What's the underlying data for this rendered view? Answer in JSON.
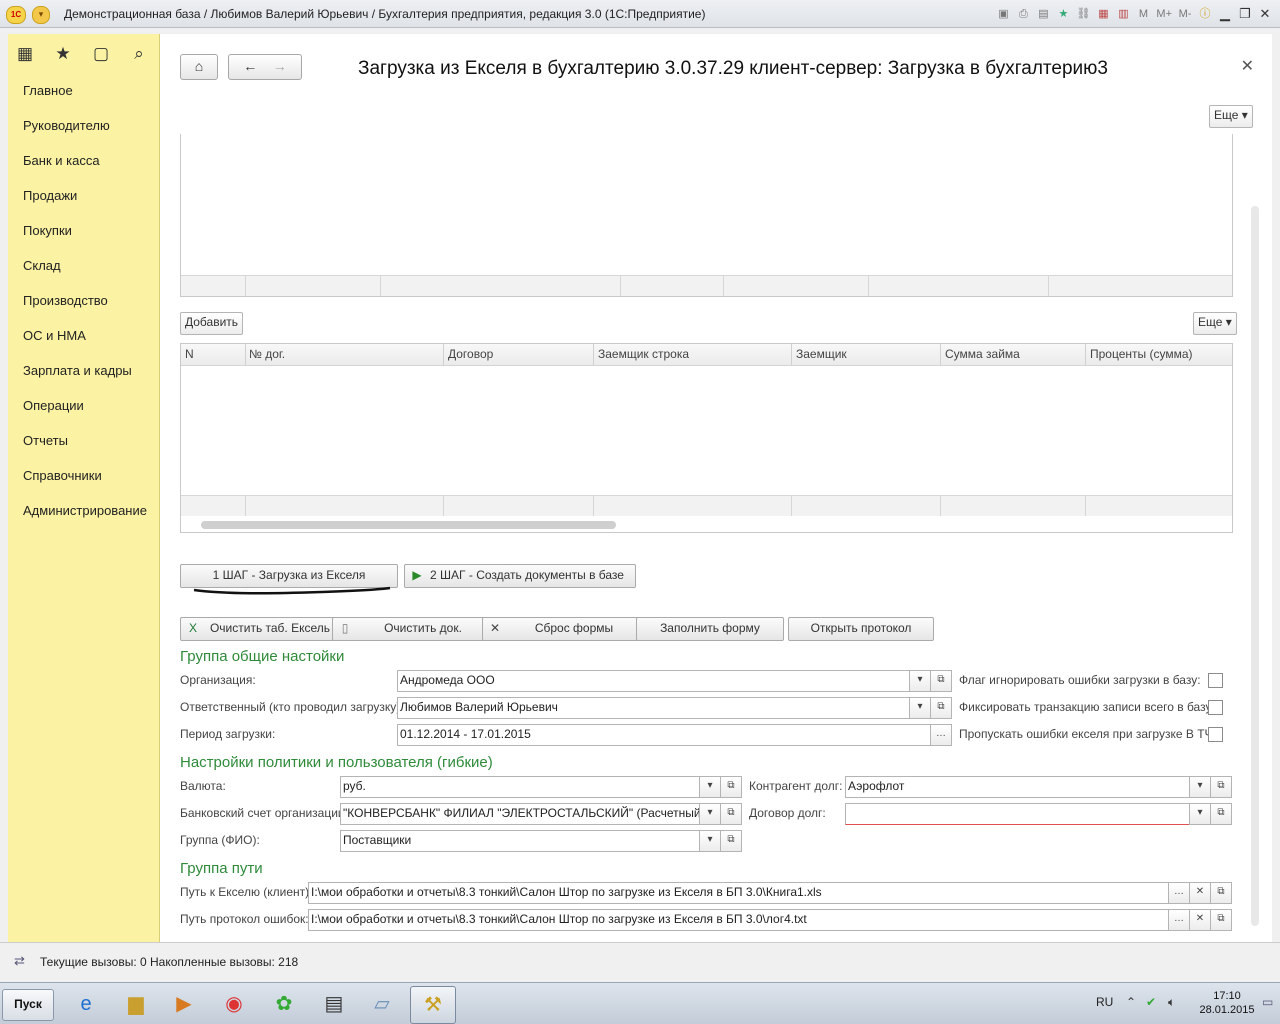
{
  "window": {
    "title": "Демонстрационная база / Любимов Валерий Юрьевич / Бухгалтерия предприятия, редакция 3.0  (1С:Предприятие)",
    "controls": [
      "M",
      "M+",
      "M-"
    ]
  },
  "sidebar": {
    "items": [
      {
        "label": "Главное"
      },
      {
        "label": "Руководителю"
      },
      {
        "label": "Банк и касса"
      },
      {
        "label": "Продажи"
      },
      {
        "label": "Покупки"
      },
      {
        "label": "Склад"
      },
      {
        "label": "Производство"
      },
      {
        "label": "ОС и НМА"
      },
      {
        "label": "Зарплата и кадры"
      },
      {
        "label": "Операции"
      },
      {
        "label": "Отчеты"
      },
      {
        "label": "Справочники"
      },
      {
        "label": "Администрирование"
      }
    ]
  },
  "form": {
    "title": "Загрузка из Екселя в бухгалтерию 3.0.37.29 клиент-сервер: Загрузка в бухгалтерию3",
    "more_label": "Еще ▾",
    "add_label": "Добавить"
  },
  "table": {
    "columns": [
      "N",
      "№ дог.",
      "Договор",
      "Заемщик строка",
      "Заемщик",
      "Сумма займа",
      "Проценты (сумма)"
    ]
  },
  "steps": {
    "step1": "1 ШАГ - Загрузка из Екселя",
    "step2": "2 ШАГ - Создать документы в базе"
  },
  "actions": {
    "clear_excel": "Очистить таб. Ексель",
    "clear_docs": "Очистить док.",
    "reset_form": "Сброс формы",
    "fill_form": "Заполнить форму",
    "open_log": "Открыть протокол"
  },
  "group_general": {
    "title": "Группа общие настойки",
    "org_label": "Организация:",
    "org_value": "Андромеда ООО",
    "resp_label": "Ответственный (кто проводил загрузку):",
    "resp_value": "Любимов Валерий Юрьевич",
    "period_label": "Период загрузки:",
    "period_value": "01.12.2014 - 17.01.2015",
    "flag1": "Флаг игнорировать ошибки загрузки в базу:",
    "flag2": "Фиксировать транзакцию записи всего в базу:",
    "flag3": "Пропускать ошибки екселя при загрузке В ТЧ:"
  },
  "group_policy": {
    "title": "Настройки политики и пользователя (гибкие)",
    "currency_label": "Валюта:",
    "currency_value": "руб.",
    "bank_label": "Банковский счет организации:",
    "bank_value": "\"КОНВЕРСБАНК\" ФИЛИАЛ \"ЭЛЕКТРОСТАЛЬСКИЙ\" (Расчетный)",
    "group_label": "Группа (ФИО):",
    "group_value": "Поставщики",
    "contractor_label": "Контрагент долг:",
    "contractor_value": "Аэрофлот",
    "contract_label": "Договор долг:",
    "contract_value": ""
  },
  "group_paths": {
    "title": "Группа пути",
    "excel_label": "Путь к Екселю (клиент):",
    "excel_value": "I:\\мои обработки и отчеты\\8.3 тонкий\\Салон Штор по загрузке из Екселя в БП 3.0\\Книга1.xls",
    "log_label": "Путь протокол ошибок:",
    "log_value": "I:\\мои обработки и отчеты\\8.3 тонкий\\Салон Штор по загрузке из Екселя в БП 3.0\\лог4.txt"
  },
  "status": {
    "text": "Текущие вызовы: 0   Накопленные вызовы: 218"
  },
  "taskbar": {
    "start": "Пуск",
    "lang": "RU",
    "time": "17:10",
    "date": "28.01.2015"
  },
  "colors": {
    "sidebar_bg": "#fbf3a3",
    "group_title": "#2f8a3a"
  }
}
